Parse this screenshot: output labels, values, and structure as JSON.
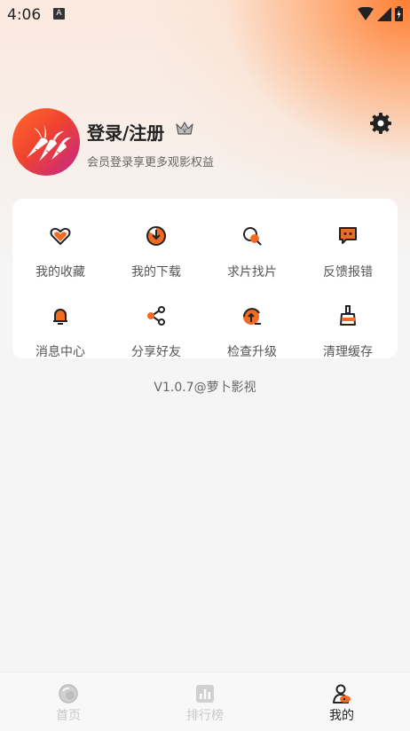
{
  "status_bar": {
    "time": "4:06",
    "notification_letter": "A"
  },
  "profile": {
    "title": "登录/注册",
    "subtitle": "会员登录享更多观影权益"
  },
  "menu": [
    {
      "label": "我的收藏",
      "icon": "heart-icon"
    },
    {
      "label": "我的下载",
      "icon": "download-icon"
    },
    {
      "label": "求片找片",
      "icon": "search-film-icon"
    },
    {
      "label": "反馈报错",
      "icon": "feedback-icon"
    },
    {
      "label": "消息中心",
      "icon": "bell-icon"
    },
    {
      "label": "分享好友",
      "icon": "share-icon"
    },
    {
      "label": "检查升级",
      "icon": "upgrade-icon"
    },
    {
      "label": "清理缓存",
      "icon": "broom-icon"
    }
  ],
  "version": "V1.0.7@萝卜影视",
  "tabs": [
    {
      "label": "首页",
      "icon": "home-icon",
      "active": false
    },
    {
      "label": "排行榜",
      "icon": "ranking-icon",
      "active": false
    },
    {
      "label": "我的",
      "icon": "profile-icon",
      "active": true
    }
  ],
  "colors": {
    "accent": "#f36b21",
    "text": "#222222",
    "muted": "#666666"
  }
}
